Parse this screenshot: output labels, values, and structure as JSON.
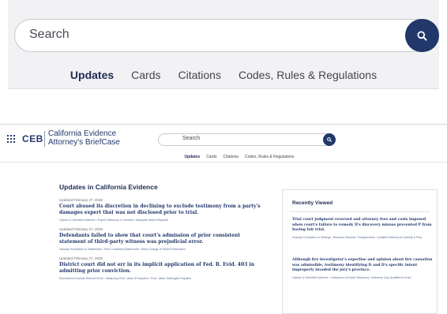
{
  "zoom": {
    "search_placeholder": "Search",
    "tabs": [
      "Updates",
      "Cards",
      "Citations",
      "Codes, Rules & Regulations"
    ]
  },
  "header": {
    "logo": "CEB",
    "brand_line1": "California Evidence",
    "brand_line2": "Attorney's BriefCase",
    "search_placeholder": "Search",
    "tabs": [
      "Updates",
      "Cards",
      "Citations",
      "Codes, Rules & Regulations"
    ]
  },
  "updates": {
    "title": "Updates in California Evidence",
    "items": [
      {
        "date": "Updated February 27, 2026",
        "headline": "Court abused its discretion in declining to exclude testimony from a party's damages expert that was not disclosed prior to trial.",
        "tags": "Opinion & Scientific Evidence › Expert Testimony: In General › Adequate Notice Required"
      },
      {
        "date": "Updated February 27, 2026",
        "headline": "Defendants failed to show that court's admission of prior consistent statement of third-party witness was prejudicial error.",
        "tags": "Hearsay Exceptions or Statements › Prior Consistent Statements › Rebut Charge of Recent Fabrication"
      },
      {
        "date": "Updated February 27, 2026",
        "headline": "District court did not err in its implicit application of Fed. R. Evid. 403 in admitting prior conviction.",
        "tags": "Discretion to Exclude Relevant Evid. › Balancing Prob. Value & Prejudice › Prob. Value Outweighs Prejudice"
      }
    ]
  },
  "recent": {
    "title": "Recently Viewed",
    "items": [
      {
        "headline": "Trial court judgment reversed and attorney fees and costs imposed when court's failure to remedy D's discovery misuse prevented P from having fair trial.",
        "tags": "Hearsay Exceptions or Writings › Business Records › Requirements › Qualified Witness for Identity & Prep"
      },
      {
        "headline": "Although fire investigator's expertise and opinion about fire causation was admissible, testimony identifying D and D's specific intent improperly invaded the jury's province.",
        "tags": "Opinion & Scientific Evidence › Limitations of Expert Testimony › Inference Jury Qualified to Draw"
      }
    ]
  },
  "colors": {
    "navy": "#22386b",
    "panel_bg": "#f2f2f4"
  }
}
